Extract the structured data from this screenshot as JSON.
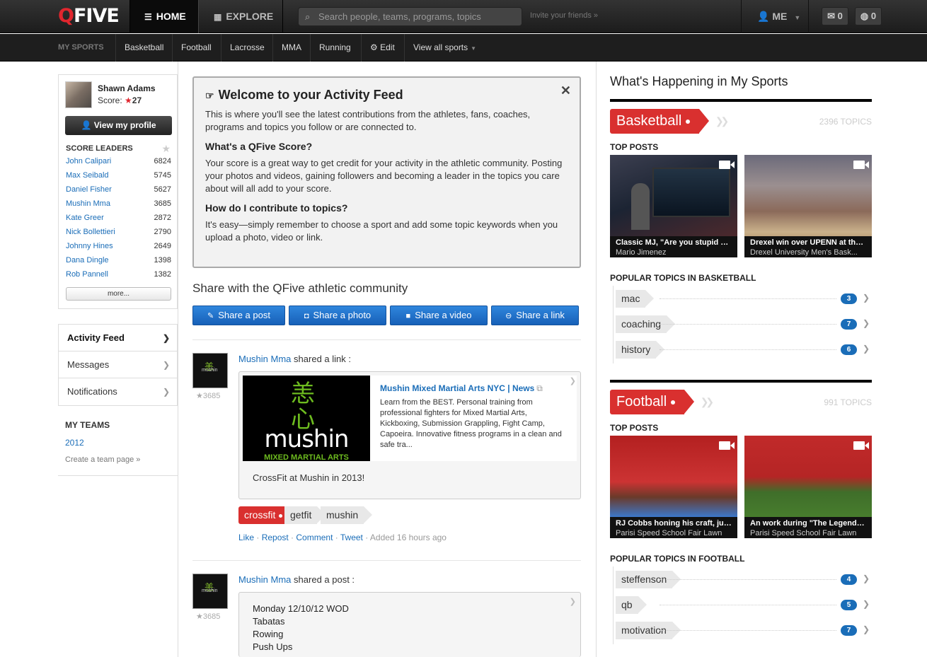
{
  "brand": {
    "logo_q": "Q",
    "logo_rest": "FIVE",
    "accent": "#e0262e"
  },
  "topnav": {
    "home": "HOME",
    "explore": "EXPLORE",
    "search_placeholder": "Search people, teams, programs, topics",
    "invite": "Invite your friends »",
    "me": "ME",
    "messages_count": "0",
    "notifications_count": "0"
  },
  "subnav": {
    "label": "MY SPORTS",
    "items": [
      "Basketball",
      "Football",
      "Lacrosse",
      "MMA",
      "Running"
    ],
    "edit": "Edit",
    "view_all": "View all sports"
  },
  "profile": {
    "name": "Shawn Adams",
    "score_label": "Score:",
    "score": "27",
    "view_profile": "View my profile"
  },
  "score_leaders": {
    "title": "SCORE LEADERS",
    "rows": [
      {
        "name": "John Calipari",
        "score": "6824"
      },
      {
        "name": "Max Seibald",
        "score": "5745"
      },
      {
        "name": "Daniel Fisher",
        "score": "5627"
      },
      {
        "name": "Mushin Mma",
        "score": "3685"
      },
      {
        "name": "Kate Greer",
        "score": "2872"
      },
      {
        "name": "Nick Bollettieri",
        "score": "2790"
      },
      {
        "name": "Johnny Hines",
        "score": "2649"
      },
      {
        "name": "Dana Dingle",
        "score": "1398"
      },
      {
        "name": "Rob Pannell",
        "score": "1382"
      }
    ],
    "more": "more..."
  },
  "menu": {
    "activity": "Activity Feed",
    "messages": "Messages",
    "notifications": "Notifications"
  },
  "teams": {
    "title": "MY TEAMS",
    "team": "2012",
    "create": "Create a team page »"
  },
  "welcome": {
    "title": "Welcome to your Activity Feed",
    "intro": "This is where you'll see the latest contributions from the athletes, fans, coaches, programs and topics you follow or are connected to.",
    "q1": "What's a QFive Score?",
    "a1": "Your score is a great way to get credit for your activity in the athletic community. Posting your photos and videos, gaining followers and becoming a leader in the topics you care about will all add to your score.",
    "q2": "How do I contribute to topics?",
    "a2": "It's easy—simply remember to choose a sport and add some topic keywords when you upload a photo, video or link."
  },
  "share": {
    "title": "Share with the QFive athletic community",
    "post": "Share a post",
    "photo": "Share a photo",
    "video": "Share a video",
    "link": "Share a link"
  },
  "feed": [
    {
      "actor": "Mushin Mma",
      "verb": "shared a link :",
      "score": "3685",
      "link_title": "Mushin Mixed Martial Arts NYC | News",
      "link_desc": "Learn from the BEST. Personal training from professional fighters for Mixed Martial Arts, Kickboxing, Submission Grappling, Fight Camp, Capoeira. Innovative fitness programs in a clean and safe tra...",
      "img_word": "mushin",
      "img_sub": "MIXED MARTIAL ARTS",
      "caption": "CrossFit at Mushin in 2013!",
      "tags": [
        "crossfit",
        "getfit",
        "mushin"
      ],
      "actions": {
        "like": "Like",
        "repost": "Repost",
        "comment": "Comment",
        "tweet": "Tweet",
        "added": "Added 16 hours ago"
      }
    },
    {
      "actor": "Mushin Mma",
      "verb": "shared a post :",
      "score": "3685",
      "lines": [
        "Monday 12/10/12 WOD",
        "Tabatas",
        "Rowing",
        "Push Ups"
      ]
    }
  ],
  "happening": {
    "title": "What's Happening in My Sports",
    "top_posts": "TOP POSTS",
    "sports": [
      {
        "name": "Basketball",
        "topics": "2396 TOPICS",
        "popular_title": "POPULAR TOPICS IN BASKETBALL",
        "posts": [
          {
            "title": "Classic MJ, \"Are you stupid ?...",
            "author": "Mario Jimenez"
          },
          {
            "title": "Drexel win over UPENN at the ...",
            "author": "Drexel University Men's Bask..."
          }
        ],
        "popular": [
          {
            "tag": "mac",
            "count": "3"
          },
          {
            "tag": "coaching",
            "count": "7"
          },
          {
            "tag": "history",
            "count": "6"
          }
        ]
      },
      {
        "name": "Football",
        "topics": "991 TOPICS",
        "popular_title": "POPULAR TOPICS IN FOOTBALL",
        "posts": [
          {
            "title": "RJ Cobbs honing his craft, just...",
            "author": "Parisi Speed School Fair Lawn"
          },
          {
            "title": "An work during \"The Legends\"...",
            "author": "Parisi Speed School Fair Lawn"
          }
        ],
        "popular": [
          {
            "tag": "steffenson",
            "count": "4"
          },
          {
            "tag": "qb",
            "count": "5"
          },
          {
            "tag": "motivation",
            "count": "7"
          }
        ]
      }
    ]
  }
}
